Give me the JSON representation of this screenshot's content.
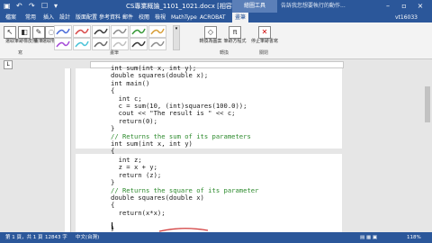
{
  "titlebar": {
    "title": "CS專業概論_1101_1021.docx [相容模式] - Word",
    "context_tab": "繪圖工具",
    "tellme": "告訴我您想要執行的動作..."
  },
  "tabs": [
    "檔案",
    "常用",
    "插入",
    "設計",
    "版面配置",
    "參考資料",
    "郵件",
    "校閱",
    "檢視",
    "MathType",
    "ACROBAT",
    "畫筆"
  ],
  "active_tab_index": 11,
  "user_label": "vt16033",
  "ribbon": {
    "tools": [
      {
        "label": "選取",
        "icon": "cursor-icon"
      },
      {
        "label": "筆跡橡皮擦",
        "icon": "eraser-icon"
      },
      {
        "label": "畫筆",
        "icon": "pen-icon"
      },
      {
        "label": "選取物件",
        "icon": "lasso-icon"
      }
    ],
    "pens_label": "畫筆",
    "ink_to_shape": {
      "label": "轉換為圖案",
      "icon": "shapes-icon"
    },
    "ink_to_math": {
      "label": "筆跡方程式",
      "icon": "math-icon"
    },
    "stop_ink": {
      "label": "停止筆跡書寫",
      "icon": "close-icon"
    },
    "group_labels": {
      "write": "寫",
      "pens": "畫筆",
      "convert": "轉換",
      "close": "關閉"
    },
    "pen_colors": [
      "#4b6cd8",
      "#d84b4b",
      "#3b3b3b",
      "#8c8c8c",
      "#3a9a3a",
      "#d8a03b",
      "#a54bd8",
      "#4bc3d8",
      "#6a6a6a",
      "#c0c0c0",
      "#3b3b3b",
      "#909090"
    ]
  },
  "document": {
    "lines_top": [
      {
        "text": "int sum(int x, int y);",
        "kind": "code"
      },
      {
        "text": "double squares(double x);",
        "kind": "code"
      },
      {
        "text": "int main()",
        "kind": "code"
      },
      {
        "text": "{",
        "kind": "code"
      },
      {
        "text": "  int c;",
        "kind": "code"
      },
      {
        "text": "  c = sum(10, (int)squares(100.0));",
        "kind": "code"
      },
      {
        "text": "  cout << \"The result is \" << c;",
        "kind": "code"
      },
      {
        "text": "  return(0);",
        "kind": "code"
      },
      {
        "text": "}",
        "kind": "code"
      },
      {
        "text": "// Returns the sum of its parameters",
        "kind": "comment"
      },
      {
        "text": "int sum(int x, int y)",
        "kind": "code"
      },
      {
        "text": "{",
        "kind": "code"
      }
    ],
    "lines_bottom": [
      {
        "text": "  int z;",
        "kind": "code"
      },
      {
        "text": "  z = x + y;",
        "kind": "code"
      },
      {
        "text": "  return (z);",
        "kind": "code"
      },
      {
        "text": "}",
        "kind": "code"
      },
      {
        "text": "// Returns the square of its parameter",
        "kind": "comment"
      },
      {
        "text": "double squares(double x)",
        "kind": "code"
      },
      {
        "text": "{",
        "kind": "code"
      },
      {
        "text": "  return(x*x);",
        "kind": "code"
      },
      {
        "text": "",
        "kind": "code"
      },
      {
        "text": "}",
        "kind": "code"
      }
    ]
  },
  "statusbar": {
    "page": "第 1 頁，共 1 頁",
    "words": "12843 字",
    "lang": "中文(台灣)",
    "zoom": "118%"
  }
}
